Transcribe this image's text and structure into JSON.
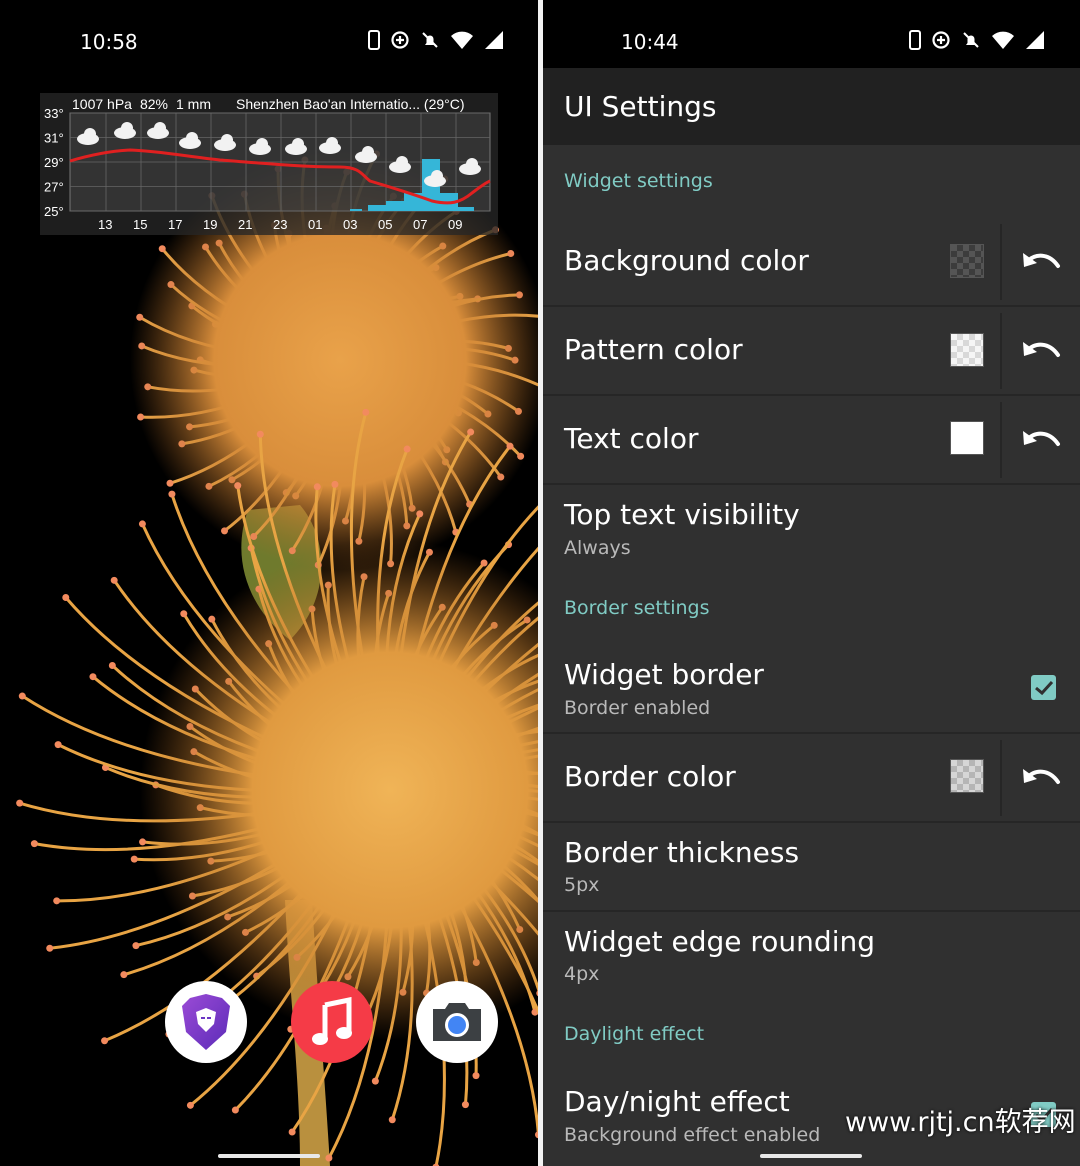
{
  "left_phone": {
    "status": {
      "time": "10:58"
    },
    "weather_widget": {
      "pressure": "1007 hPa",
      "humidity": "82%",
      "precip": "1 mm",
      "location": "Shenzhen Bao'an Internatio... (29°C)",
      "y_ticks": [
        "33°",
        "31°",
        "29°",
        "27°",
        "25°"
      ],
      "x_ticks": [
        "13",
        "15",
        "17",
        "19",
        "21",
        "23",
        "01",
        "03",
        "05",
        "07",
        "09"
      ],
      "line_color": "#e02020",
      "bar_color": "#35b6d8"
    },
    "dock": {
      "apps": [
        {
          "name": "brave-browser-icon",
          "bg": "#ffffff"
        },
        {
          "name": "music-icon",
          "bg": "#f53b47"
        },
        {
          "name": "camera-icon",
          "bg": "#ffffff"
        }
      ]
    }
  },
  "right_phone": {
    "status": {
      "time": "10:44"
    },
    "appbar": {
      "title": "UI Settings"
    },
    "accent_color": "#80cbc4",
    "sections": {
      "widget": "Widget settings",
      "border": "Border settings",
      "daylight": "Daylight effect"
    },
    "rows": {
      "background_color": {
        "title": "Background color"
      },
      "pattern_color": {
        "title": "Pattern color"
      },
      "text_color": {
        "title": "Text color"
      },
      "top_text_visibility": {
        "title": "Top text visibility",
        "subtitle": "Always"
      },
      "widget_border": {
        "title": "Widget border",
        "subtitle": "Border enabled",
        "checked": true
      },
      "border_color": {
        "title": "Border color"
      },
      "border_thickness": {
        "title": "Border thickness",
        "subtitle": "5px"
      },
      "edge_rounding": {
        "title": "Widget edge rounding",
        "subtitle": "4px"
      },
      "day_night": {
        "title": "Day/night effect",
        "subtitle": "Background effect enabled",
        "checked": true
      }
    },
    "watermark": "www.rjtj.cn软荐网"
  }
}
